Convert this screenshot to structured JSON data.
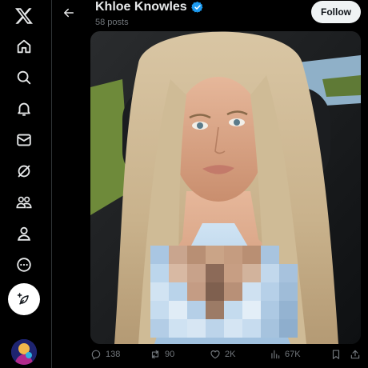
{
  "nav": {
    "items": [
      {
        "icon": "x-logo-icon"
      },
      {
        "icon": "home-icon"
      },
      {
        "icon": "search-icon"
      },
      {
        "icon": "notifications-icon"
      },
      {
        "icon": "messages-icon"
      },
      {
        "icon": "grok-icon"
      },
      {
        "icon": "communities-icon"
      },
      {
        "icon": "profile-icon"
      },
      {
        "icon": "more-icon"
      }
    ],
    "compose_icon": "compose-post-icon"
  },
  "header": {
    "name": "Khloe Knowles",
    "verified": true,
    "posts_count": "58 posts",
    "follow_label": "Follow"
  },
  "media": {
    "description_hidden": true,
    "pixelated_region": true
  },
  "actions": {
    "replies": "138",
    "reposts": "90",
    "likes": "2K",
    "views": "67K"
  },
  "colors": {
    "background": "#000000",
    "text_primary": "#e7e9ea",
    "text_secondary": "#71767b",
    "verified_blue": "#1d9bf0",
    "follow_bg": "#eff3f4"
  }
}
